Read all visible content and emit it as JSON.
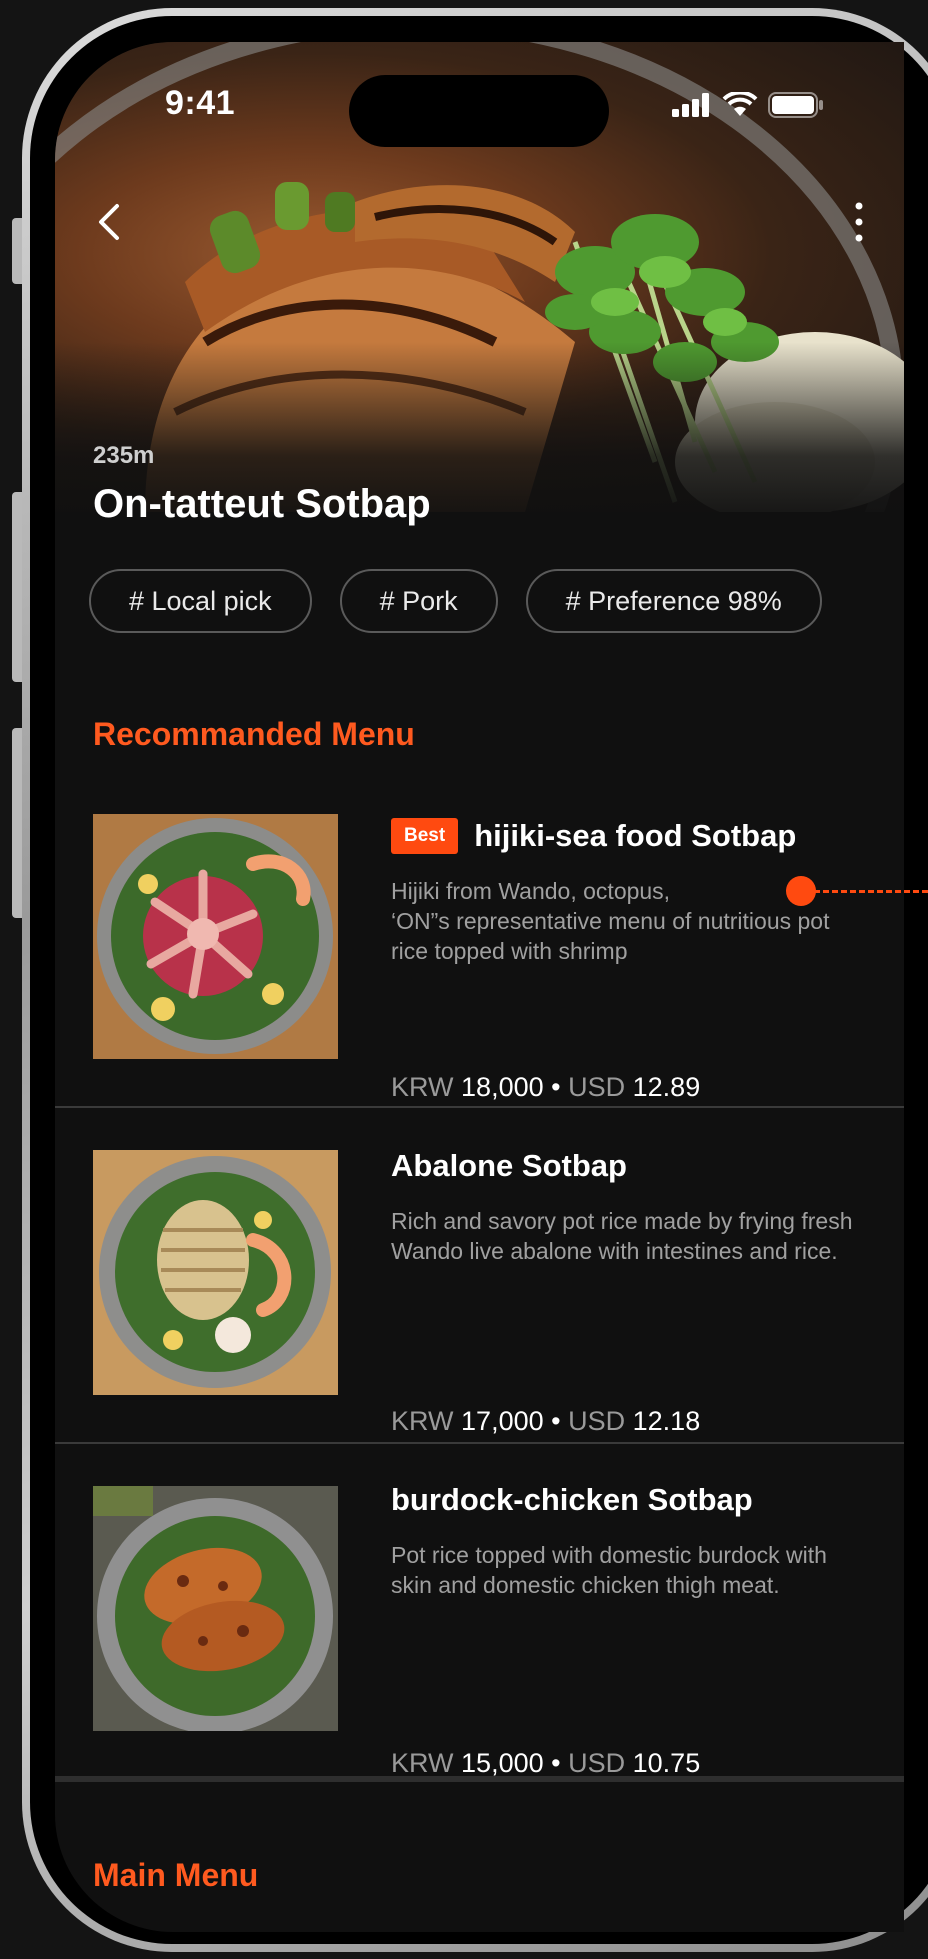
{
  "status": {
    "time": "9:41"
  },
  "place": {
    "distance": "235m",
    "title": "On-tatteut Sotbap",
    "tags": [
      "# Local pick",
      "# Pork",
      "# Preference 98%"
    ]
  },
  "sections": {
    "recommended": "Recommanded Menu",
    "main": "Main Menu"
  },
  "menu": [
    {
      "badge": "Best",
      "name": "hijiki-sea food Sotbap",
      "desc": "Hijiki from Wando, octopus,\n‘ON”s representative menu of nutritious pot rice topped with shrimp",
      "cur1": "KRW",
      "krw": "18,000",
      "sep": "•",
      "cur2": "USD",
      "usd": "12.89"
    },
    {
      "name": "Abalone Sotbap",
      "desc": "Rich and savory pot rice made by frying fresh Wando live abalone with intestines and rice.",
      "cur1": "KRW",
      "krw": "17,000",
      "sep": "•",
      "cur2": "USD",
      "usd": "12.18"
    },
    {
      "name": "burdock-chicken Sotbap",
      "desc": "Pot rice topped with domestic burdock with skin and domestic chicken thigh meat.",
      "cur1": "KRW",
      "krw": "15,000",
      "sep": "•",
      "cur2": "USD",
      "usd": "10.75"
    }
  ],
  "colors": {
    "accent": "#ff4a10",
    "background": "#101010"
  },
  "icons": [
    "back-icon",
    "more-icon",
    "signal-icon",
    "wifi-icon",
    "battery-icon"
  ]
}
